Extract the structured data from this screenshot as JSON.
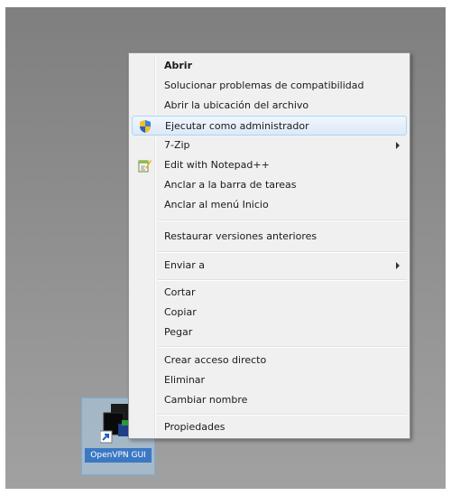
{
  "desktop_icon": {
    "label": "OpenVPN GUI",
    "icon": "openvpn-shortcut-icon"
  },
  "context_menu": {
    "items": [
      {
        "id": "abrir",
        "label": "Abrir",
        "bold": true
      },
      {
        "id": "compat",
        "label": "Solucionar problemas de compatibilidad"
      },
      {
        "id": "ubicacion",
        "label": "Abrir la ubicación del archivo"
      },
      {
        "id": "admin",
        "label": "Ejecutar como administrador",
        "icon": "uac-shield-icon",
        "highlighted": true
      },
      {
        "id": "zip",
        "label": "7-Zip",
        "submenu": true
      },
      {
        "id": "notepad",
        "label": "Edit with Notepad++",
        "icon": "notepad-plus-plus-icon"
      },
      {
        "id": "taskbar",
        "label": "Anclar a la barra de tareas"
      },
      {
        "id": "inicio",
        "label": "Anclar al menú Inicio"
      },
      {
        "id": "restaurar",
        "label": "Restaurar versiones anteriores"
      },
      {
        "id": "enviar",
        "label": "Enviar a",
        "submenu": true
      },
      {
        "id": "cortar",
        "label": "Cortar"
      },
      {
        "id": "copiar",
        "label": "Copiar"
      },
      {
        "id": "pegar",
        "label": "Pegar"
      },
      {
        "id": "acceso",
        "label": "Crear acceso directo"
      },
      {
        "id": "eliminar",
        "label": "Eliminar"
      },
      {
        "id": "renombrar",
        "label": "Cambiar nombre"
      },
      {
        "id": "propiedades",
        "label": "Propiedades"
      }
    ]
  },
  "colors": {
    "menu_background": "#f0f0f0",
    "highlight_border": "#a8d8f5",
    "selection_blue": "#3b78c4"
  }
}
